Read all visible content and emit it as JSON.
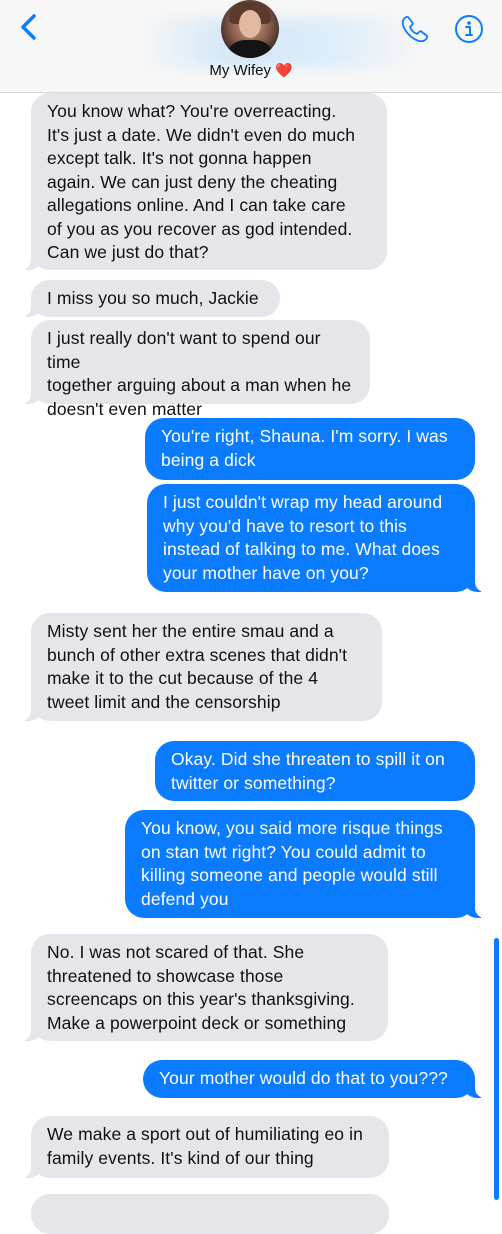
{
  "header": {
    "contact_name": "My Wifey",
    "contact_emoji": "❤️",
    "back_icon": "chevron-left-icon",
    "phone_icon": "phone-icon",
    "info_icon": "info-icon",
    "accent_color": "#0b7cff"
  },
  "messages": [
    {
      "side": "in",
      "text": "You know what? You're overreacting.\nIt's just a date. We didn't even do much\nexcept talk. It's not gonna happen\nagain. We can just deny the cheating\nallegations online. And I can take care\nof you as you recover as god intended.\nCan we just do that?"
    },
    {
      "side": "in",
      "text": "I miss you so much, Jackie"
    },
    {
      "side": "in",
      "text": "I just really don't want to spend our time\ntogether arguing about a man when he\ndoesn't even matter"
    },
    {
      "side": "out",
      "text": "You're right, Shauna. I'm sorry. I was\nbeing a dick"
    },
    {
      "side": "out",
      "text": "I just couldn't wrap my head around\nwhy you'd have to resort to this\ninstead of talking to me. What does\nyour mother have on you?"
    },
    {
      "side": "in",
      "text": "Misty sent her the entire smau and a\nbunch of other extra scenes that didn't\nmake it to the cut because of the 4\ntweet limit and the censorship"
    },
    {
      "side": "out",
      "text": "Okay. Did she threaten to spill it on\ntwitter or something?"
    },
    {
      "side": "out",
      "text": "You know, you said more risque things\non stan twt right? You could admit to\nkilling someone and people would still\ndefend you"
    },
    {
      "side": "in",
      "text": "No. I was not scared of that. She\nthreatened to showcase those\nscreencaps on this year's thanksgiving.\nMake a powerpoint deck or something"
    },
    {
      "side": "out",
      "text": "Your mother would do that to you???"
    },
    {
      "side": "in",
      "text": "We make a sport out of humiliating eo in\nfamily events. It's kind of our thing"
    }
  ]
}
